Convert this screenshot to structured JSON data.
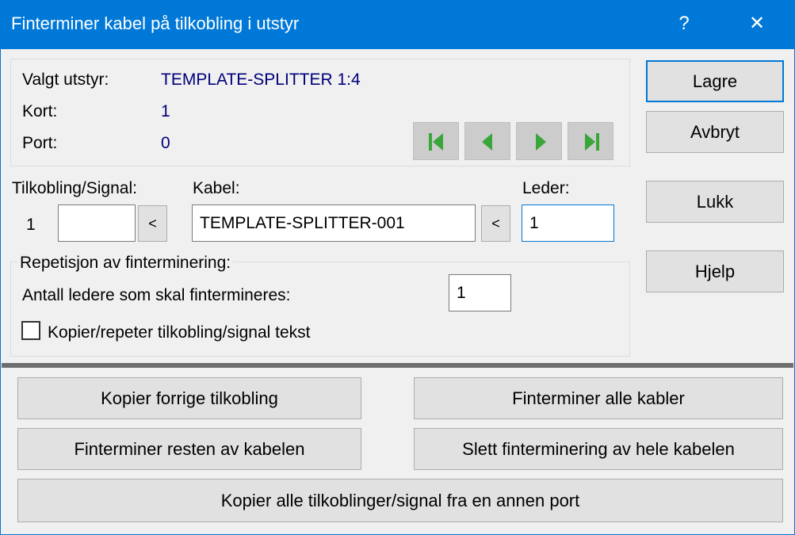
{
  "window": {
    "title": "Finterminer kabel på tilkobling i utstyr",
    "help_label": "?",
    "close_label": "✕"
  },
  "info": {
    "equipment_label": "Valgt utstyr:",
    "equipment_value": "TEMPLATE-SPLITTER 1:4",
    "card_label": "Kort:",
    "card_value": "1",
    "port_label": "Port:",
    "port_value": "0"
  },
  "navigation": {
    "icons": [
      "first-icon",
      "previous-icon",
      "next-icon",
      "last-icon"
    ],
    "color": "#3aa63a"
  },
  "fields": {
    "connection_label": "Tilkobling/Signal:",
    "connection_index": "1",
    "connection_value": "",
    "connection_pick_label": "<",
    "cable_label": "Kabel:",
    "cable_value": "TEMPLATE-SPLITTER-001",
    "cable_pick_label": "<",
    "conductor_label": "Leder:",
    "conductor_value": "1"
  },
  "repetition": {
    "group_label": "Repetisjon av finterminering:",
    "count_label": "Antall ledere som skal fintermineres:",
    "count_value": "1",
    "copy_checkbox_label": "Kopier/repeter tilkobling/signal tekst",
    "copy_checked": false
  },
  "side_buttons": {
    "save": "Lagre",
    "cancel": "Avbryt",
    "close": "Lukk",
    "help": "Hjelp"
  },
  "bottom_buttons": {
    "copy_previous": "Kopier forrige tilkobling",
    "terminate_all": "Finterminer alle kabler",
    "terminate_rest": "Finterminer resten av kabelen",
    "delete_all": "Slett finterminering av hele kabelen",
    "copy_from_port": "Kopier alle tilkoblinger/signal fra en annen port"
  },
  "colors": {
    "titlebar": "#0078d7",
    "value_text": "#00007a",
    "focus_border": "#0078d7"
  }
}
